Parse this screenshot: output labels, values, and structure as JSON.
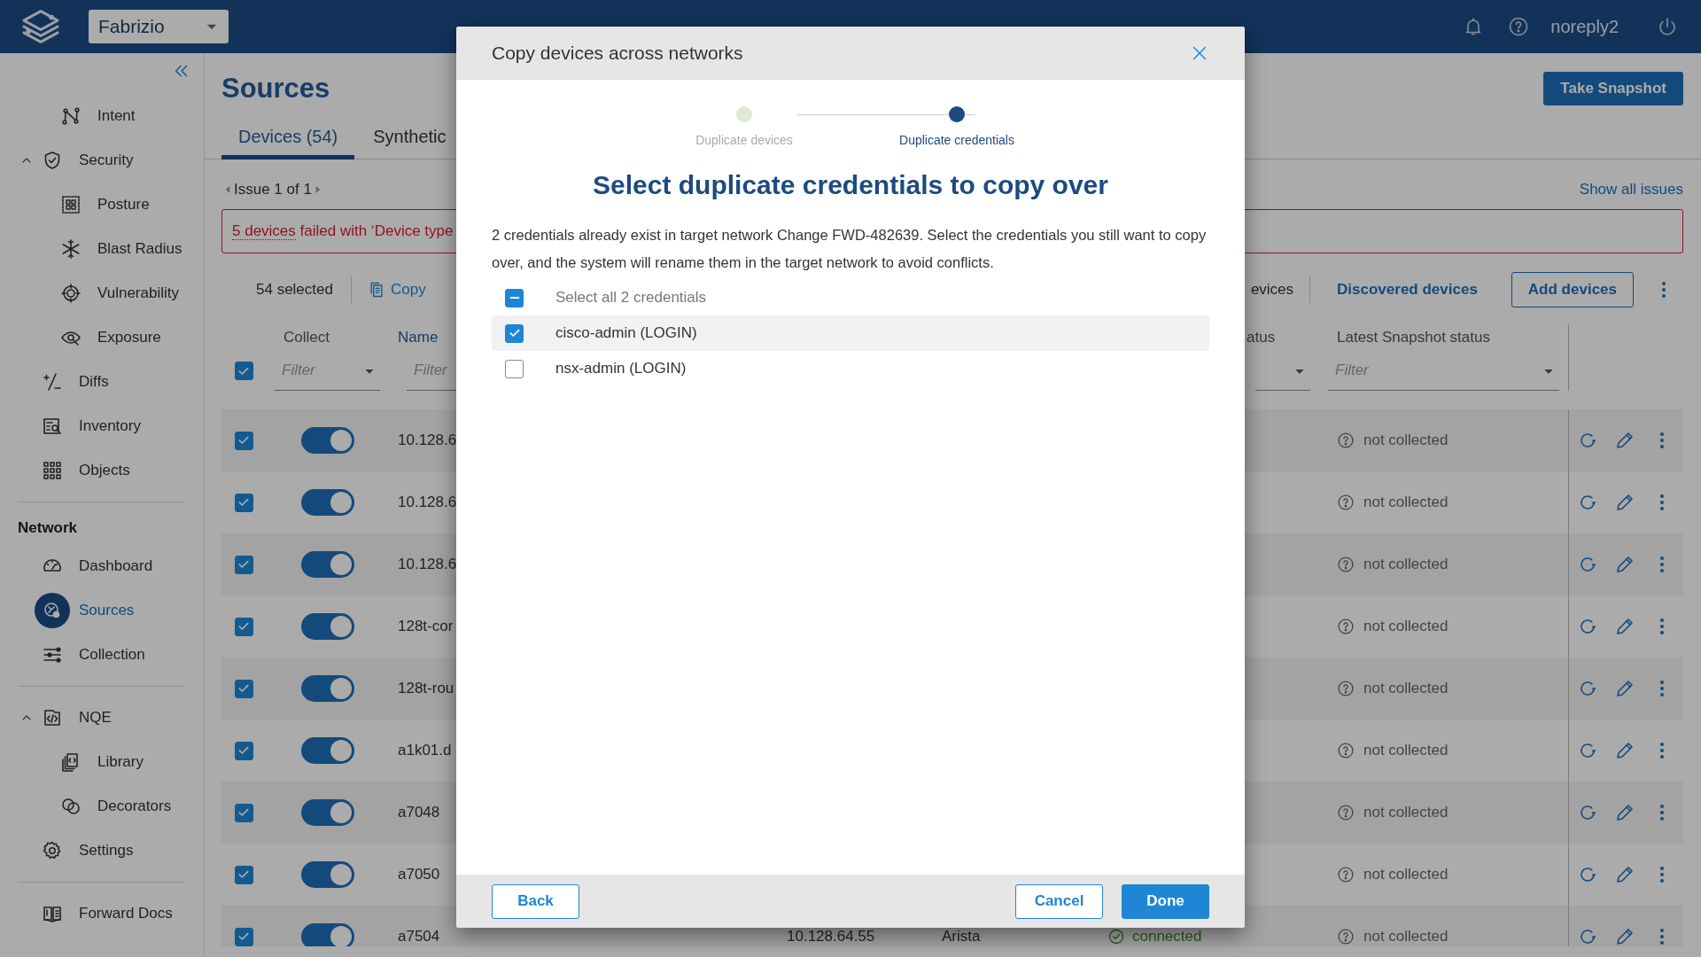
{
  "topbar": {
    "workspace": "Fabrizio",
    "user": "noreply2"
  },
  "sidebar": {
    "sections": [
      {
        "items": [
          {
            "children": [
              {
                "label": "Intent",
                "selected": false
              }
            ]
          },
          {
            "label": "Security",
            "selected": false,
            "expanded": true,
            "children": [
              {
                "label": "Posture",
                "selected": false
              },
              {
                "label": "Blast Radius",
                "selected": false
              },
              {
                "label": "Vulnerability",
                "selected": false
              },
              {
                "label": "Exposure",
                "selected": false
              }
            ]
          },
          {
            "label": "Diffs",
            "selected": false
          },
          {
            "label": "Inventory",
            "selected": false
          },
          {
            "label": "Objects",
            "selected": false
          }
        ]
      },
      {
        "title": "Network",
        "items": [
          {
            "label": "Dashboard",
            "selected": false
          },
          {
            "label": "Sources",
            "selected": true
          },
          {
            "label": "Collection",
            "selected": false
          }
        ]
      },
      {
        "items": [
          {
            "label": "NQE",
            "selected": false,
            "expanded": true,
            "children": [
              {
                "label": "Library",
                "selected": false
              },
              {
                "label": "Decorators",
                "selected": false
              }
            ]
          },
          {
            "label": "Settings",
            "selected": false
          }
        ]
      },
      {
        "items": [
          {
            "label": "Forward Docs",
            "selected": false
          }
        ]
      }
    ]
  },
  "page": {
    "title": "Sources",
    "action": "Take Snapshot",
    "tabs": [
      {
        "label": "Devices (54)",
        "selected": true
      },
      {
        "label": "Synthetic",
        "selected": false
      }
    ],
    "issues": {
      "pager": "Issue 1 of 1",
      "link": "Show all issues",
      "message_link": "5 devices",
      "message": "failed with ‘Device type"
    },
    "toolbar": {
      "selected": "54 selected",
      "copy": "Copy",
      "view_option": "evices",
      "discovered": "Discovered devices",
      "add": "Add devices"
    }
  },
  "table": {
    "all_checked": true,
    "columns": [
      {
        "kind": "collect",
        "label": "Collect",
        "placeholder": "Filter",
        "dropdown": true
      },
      {
        "kind": "name",
        "label": "Name",
        "placeholder": "Filter"
      },
      {
        "kind": "status",
        "label": "atus",
        "dropdown": true
      },
      {
        "kind": "snapshot",
        "label": "Latest Snapshot status",
        "placeholder": "Filter",
        "dropdown": true
      }
    ],
    "rows": [
      {
        "checked": true,
        "collect": true,
        "name": "10.128.6",
        "snapshot": "not collected"
      },
      {
        "checked": true,
        "collect": true,
        "name": "10.128.6",
        "snapshot": "not collected"
      },
      {
        "checked": true,
        "collect": true,
        "name": "10.128.6",
        "snapshot": "not collected"
      },
      {
        "checked": true,
        "collect": true,
        "name": "128t-cor",
        "snapshot": "not collected"
      },
      {
        "checked": true,
        "collect": true,
        "name": "128t-rou",
        "snapshot": "not collected"
      },
      {
        "checked": true,
        "collect": true,
        "name": "a1k01.d",
        "snapshot": "not collected"
      },
      {
        "checked": true,
        "collect": true,
        "name": "a7048",
        "snapshot": "not collected"
      },
      {
        "checked": true,
        "collect": true,
        "name": "a7050",
        "snapshot": "not collected"
      },
      {
        "checked": true,
        "collect": true,
        "name": "a7504",
        "ip": "10.128.64.55",
        "vendor": "Arista",
        "status": "connected",
        "snapshot": "not collected"
      }
    ]
  },
  "dialog": {
    "title": "Copy devices across networks",
    "steps": [
      {
        "label": "Duplicate devices",
        "selected": false
      },
      {
        "label": "Duplicate credentials",
        "selected": true
      }
    ],
    "heading": "Select duplicate credentials to copy over",
    "description": "2 credentials already exist in target network Change FWD-482639. Select the credentials you still want to copy over, and the system will rename them in the target network to avoid conflicts.",
    "select_all": {
      "label": "Select all 2 credentials",
      "indeterminate": true
    },
    "credentials": [
      {
        "label": "cisco-admin (LOGIN)",
        "checked": true,
        "highlighted": true
      },
      {
        "label": "nsx-admin (LOGIN)",
        "checked": false,
        "highlighted": false
      }
    ],
    "buttons": {
      "back": "Back",
      "cancel": "Cancel",
      "done": "Done"
    }
  }
}
